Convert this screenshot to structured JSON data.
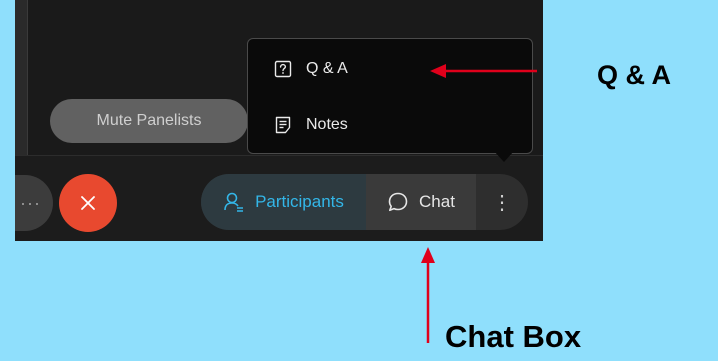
{
  "toolbar": {
    "mute_panelists_label": "Mute Panelists",
    "more_label": "···",
    "participants_label": "Participants",
    "chat_label": "Chat",
    "more_options_label": "⋮"
  },
  "menu": {
    "items": [
      {
        "label": "Q & A",
        "icon": "question-box-icon"
      },
      {
        "label": "Notes",
        "icon": "notes-icon"
      }
    ]
  },
  "annotations": {
    "qa_callout": "Q & A",
    "chat_callout": "Chat Box"
  },
  "colors": {
    "page_background": "#8fdffc",
    "end_call_red": "#e8492f",
    "participants_blue": "#33b6e8",
    "arrow_red": "#e0001b"
  }
}
